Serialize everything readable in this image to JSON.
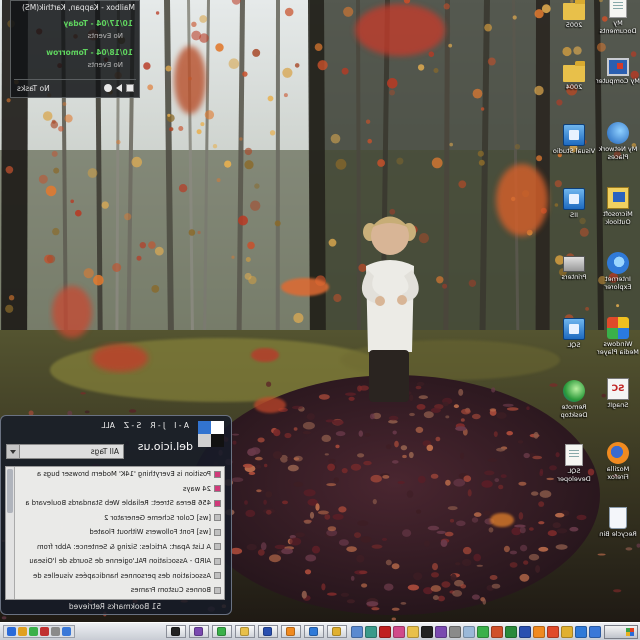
{
  "outlook_widget": {
    "title": "Mailbox - Kappan, Karthik(MS)",
    "days": [
      {
        "date": "10/17/04 - Today",
        "events": "No Events"
      },
      {
        "date": "10/18/04 - Tomorrow",
        "events": "No Events"
      }
    ],
    "tasks": "No Tasks"
  },
  "desktop_icons": [
    {
      "label": "My Documents",
      "icon": "document-icon"
    },
    {
      "label": "My Computer",
      "icon": "monitor-icon"
    },
    {
      "label": "My Network Places",
      "icon": "network-icon"
    },
    {
      "label": "Microsoft Outlook",
      "icon": "outlook-icon"
    },
    {
      "label": "Internet Explorer",
      "icon": "internet-explorer-icon"
    },
    {
      "label": "Windows Media Player",
      "icon": "media-player-icon"
    },
    {
      "label": "SnagIt",
      "icon": "snagit-icon"
    },
    {
      "label": "Mozilla Firefox",
      "icon": "firefox-icon"
    },
    {
      "label": "Recycle Bin",
      "icon": "recycle-bin-icon"
    },
    {
      "label": "2005",
      "icon": "folder-icon"
    },
    {
      "label": "2004",
      "icon": "folder-icon"
    },
    {
      "label": "Visual Studio",
      "icon": "application-icon"
    },
    {
      "label": "IIS",
      "icon": "application-icon"
    },
    {
      "label": "Printers",
      "icon": "printer-icon"
    },
    {
      "label": "SQL",
      "icon": "application-icon"
    },
    {
      "label": "Remote Desktop",
      "icon": "globe-icon"
    },
    {
      "label": "SQL Developer",
      "icon": "document-icon"
    }
  ],
  "delicious": {
    "index_links": [
      "A - I",
      "J - R",
      "S - Z",
      "ALL"
    ],
    "title": "del.icio.us",
    "tag_filter": "All Tags",
    "bookmarks": [
      {
        "title": "Position is Everything '14K' Modern browser bugs a",
        "favicon_color": "#d03a7a"
      },
      {
        "title": "24 ways",
        "favicon_color": "#d03a7a"
      },
      {
        "title": "456 Berea Street: Reliable Web Standards Boulevard a",
        "favicon_color": "#d03a7a"
      },
      {
        "title": "[ws] Color Scheme Generator 2",
        "favicon_color": "#c0c0c0"
      },
      {
        "title": "[ws] Font Followers Without Floated",
        "favicon_color": "#c0c0c0"
      },
      {
        "title": "A List Apart: Articles: Sizing & Sentence: Abbr from",
        "favicon_color": "#c0c0c0"
      },
      {
        "title": "AIRD - Association PAL'ogienne de Sourds de l'Oiseau",
        "favicon_color": "#c0c0c0"
      },
      {
        "title": "Association des personnes handicapées visuelles de",
        "favicon_color": "#c0c0c0"
      },
      {
        "title": "Bonnes Custom Frames",
        "favicon_color": "#c0c0c0"
      }
    ],
    "status": "51 Bookmarks Retrieved",
    "logo_colors": [
      "#ffffff",
      "#3274d0",
      "#111111",
      "#d0d0d0"
    ]
  },
  "taskbar": {
    "quick_launch": [
      {
        "icon": "desktop-icon",
        "color": "#3a78d8"
      },
      {
        "icon": "internet-explorer-icon",
        "color": "#2f7ad8"
      },
      {
        "icon": "outlook-icon",
        "color": "#e0b030"
      },
      {
        "icon": "media-player-icon",
        "color": "#e04a2a"
      },
      {
        "icon": "firefox-icon",
        "color": "#f08a20"
      },
      {
        "icon": "word-icon",
        "color": "#2a50b0"
      },
      {
        "icon": "excel-icon",
        "color": "#2a8a3a"
      },
      {
        "icon": "powerpoint-icon",
        "color": "#d0502a"
      },
      {
        "icon": "messenger-icon",
        "color": "#3ab04a"
      },
      {
        "icon": "notepad-icon",
        "color": "#9ab8d8"
      },
      {
        "icon": "calculator-icon",
        "color": "#8a8a8a"
      },
      {
        "icon": "visual-studio-icon",
        "color": "#7a4ab0"
      },
      {
        "icon": "command-prompt-icon",
        "color": "#222222"
      },
      {
        "icon": "explorer-icon",
        "color": "#e8c04a"
      },
      {
        "icon": "paint-icon",
        "color": "#d04a8a"
      },
      {
        "icon": "acrobat-icon",
        "color": "#c02020"
      },
      {
        "icon": "remote-desktop-icon",
        "color": "#3a9a8a"
      },
      {
        "icon": "search-icon",
        "color": "#5a8ad0"
      }
    ],
    "tasks": [
      {
        "icon": "outlook-icon",
        "color": "#e0b030"
      },
      {
        "icon": "internet-explorer-icon",
        "color": "#2f7ad8"
      },
      {
        "icon": "firefox-icon",
        "color": "#f08a20"
      },
      {
        "icon": "word-icon",
        "color": "#2a50b0"
      },
      {
        "icon": "explorer-icon",
        "color": "#e8c04a"
      },
      {
        "icon": "messenger-icon",
        "color": "#3ab04a"
      },
      {
        "icon": "visual-studio-icon",
        "color": "#7a4ab0"
      },
      {
        "icon": "command-prompt-icon",
        "color": "#222222"
      }
    ],
    "tray": [
      {
        "icon": "network-tray-icon",
        "color": "#3a78d8"
      },
      {
        "icon": "volume-tray-icon",
        "color": "#8a8a8a"
      },
      {
        "icon": "security-tray-icon",
        "color": "#c03030"
      },
      {
        "icon": "messenger-tray-icon",
        "color": "#3ab04a"
      },
      {
        "icon": "antivirus-tray-icon",
        "color": "#e0a020"
      },
      {
        "icon": "update-tray-icon",
        "color": "#2a6ad8"
      }
    ]
  },
  "colors": {
    "calendar_date": "#5fd35f",
    "widget_background": "#121416",
    "taskbar": "#d8dce4"
  }
}
